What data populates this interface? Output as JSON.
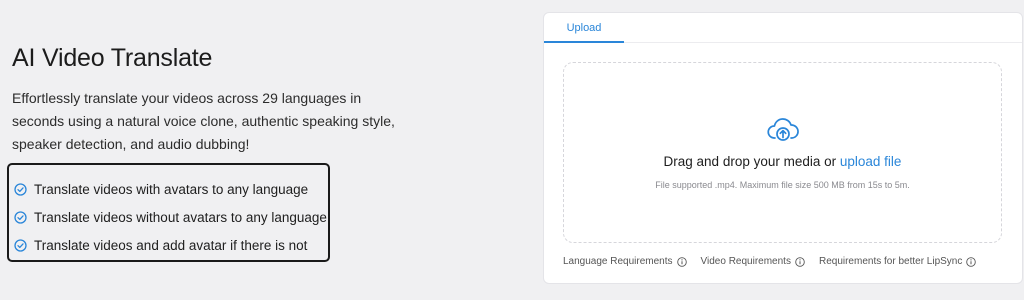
{
  "hero": {
    "title": "AI Video Translate",
    "description": "Effortlessly translate your videos across 29 languages in seconds using a natural voice clone, authentic speaking style, speaker detection, and audio dubbing!",
    "features": [
      "Translate videos with avatars to any language",
      "Translate videos without avatars to any language",
      "Translate videos and add avatar if there is not"
    ],
    "check_icon": "check-circle-icon"
  },
  "upload_card": {
    "tabs": [
      {
        "label": "Upload",
        "active": true
      }
    ],
    "dropzone": {
      "icon": "cloud-upload-icon",
      "text": "Drag and drop your media or",
      "link_text": "upload file",
      "hint": "File supported .mp4. Maximum file size 500 MB from 15s to 5m."
    },
    "requirements": [
      {
        "label": "Language Requirements",
        "icon": "info-icon"
      },
      {
        "label": "Video Requirements",
        "icon": "info-icon"
      },
      {
        "label": "Requirements for better LipSync",
        "icon": "info-icon"
      }
    ]
  },
  "colors": {
    "background": "#f0f0f2",
    "accent": "#2a86d9",
    "text": "#222222",
    "muted": "#8a8a8f"
  }
}
